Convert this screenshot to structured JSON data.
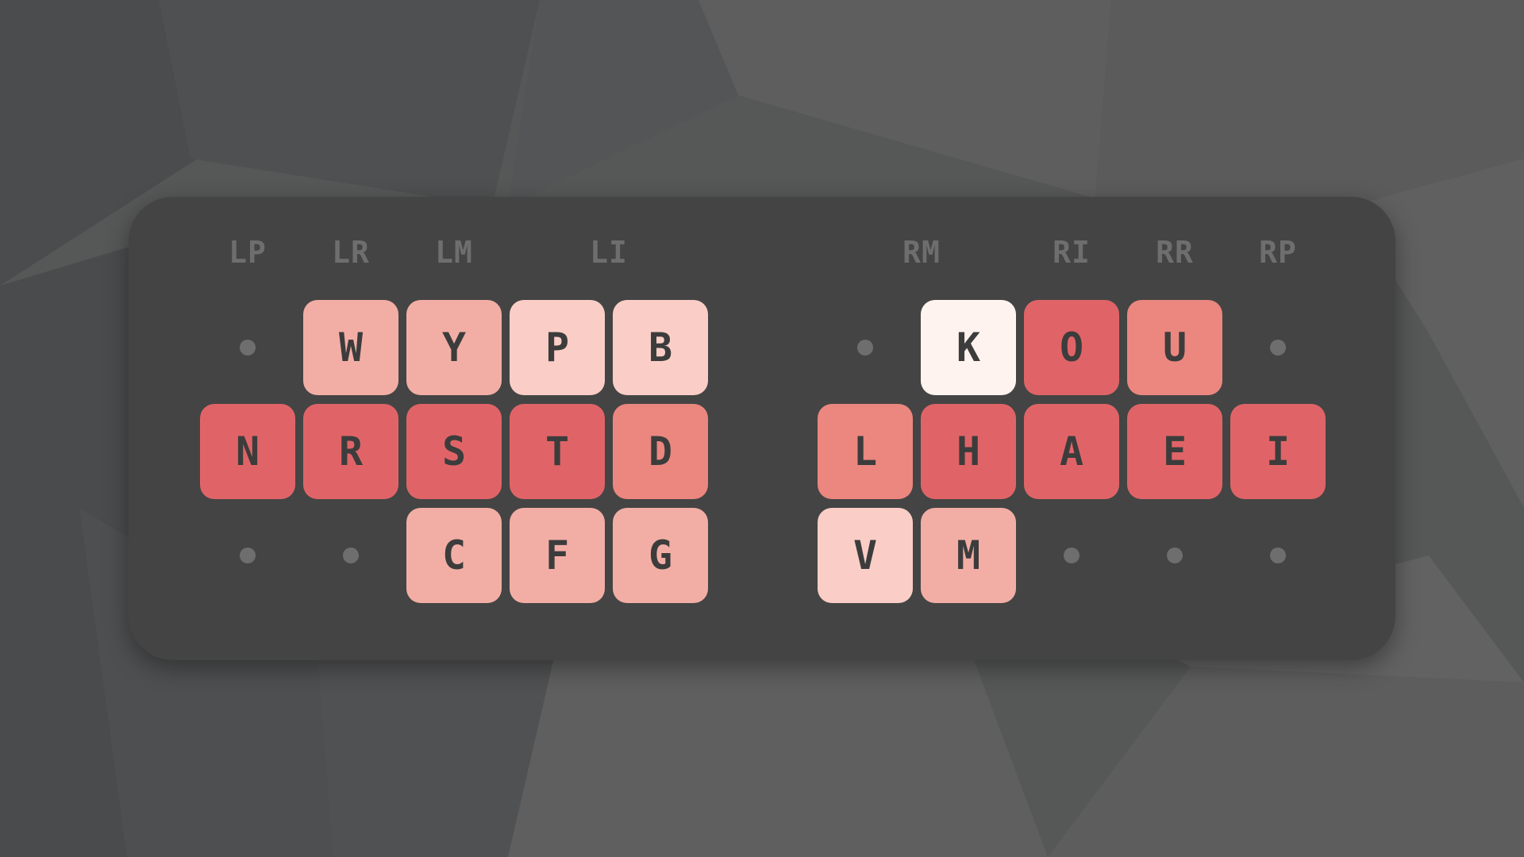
{
  "fingers": [
    {
      "id": "lp",
      "label": "LP"
    },
    {
      "id": "lr",
      "label": "LR"
    },
    {
      "id": "lm",
      "label": "LM"
    },
    {
      "id": "li",
      "label": "LI"
    },
    {
      "id": "rm",
      "label": "RM"
    },
    {
      "id": "ri",
      "label": "RI"
    },
    {
      "id": "rr",
      "label": "RR"
    },
    {
      "id": "rp",
      "label": "RP"
    }
  ],
  "heat_colors": {
    "0": "#fff3ef",
    "1": "#facec6",
    "2": "#f2aea5",
    "3": "#eb877f",
    "4": "#e06467"
  },
  "left_hand": [
    [
      null,
      {
        "letter": "W",
        "heat": 2
      },
      {
        "letter": "Y",
        "heat": 2
      },
      {
        "letter": "P",
        "heat": 1
      },
      {
        "letter": "B",
        "heat": 1
      }
    ],
    [
      {
        "letter": "N",
        "heat": 4
      },
      {
        "letter": "R",
        "heat": 4
      },
      {
        "letter": "S",
        "heat": 4
      },
      {
        "letter": "T",
        "heat": 4
      },
      {
        "letter": "D",
        "heat": 3
      }
    ],
    [
      null,
      null,
      {
        "letter": "C",
        "heat": 2
      },
      {
        "letter": "F",
        "heat": 2
      },
      {
        "letter": "G",
        "heat": 2
      }
    ]
  ],
  "right_hand": [
    [
      null,
      {
        "letter": "K",
        "heat": 0
      },
      {
        "letter": "O",
        "heat": 4
      },
      {
        "letter": "U",
        "heat": 3
      },
      null
    ],
    [
      {
        "letter": "L",
        "heat": 3
      },
      {
        "letter": "H",
        "heat": 4
      },
      {
        "letter": "A",
        "heat": 4
      },
      {
        "letter": "E",
        "heat": 4
      },
      {
        "letter": "I",
        "heat": 4
      }
    ],
    [
      {
        "letter": "V",
        "heat": 1
      },
      {
        "letter": "M",
        "heat": 2
      },
      null,
      null,
      null
    ]
  ]
}
